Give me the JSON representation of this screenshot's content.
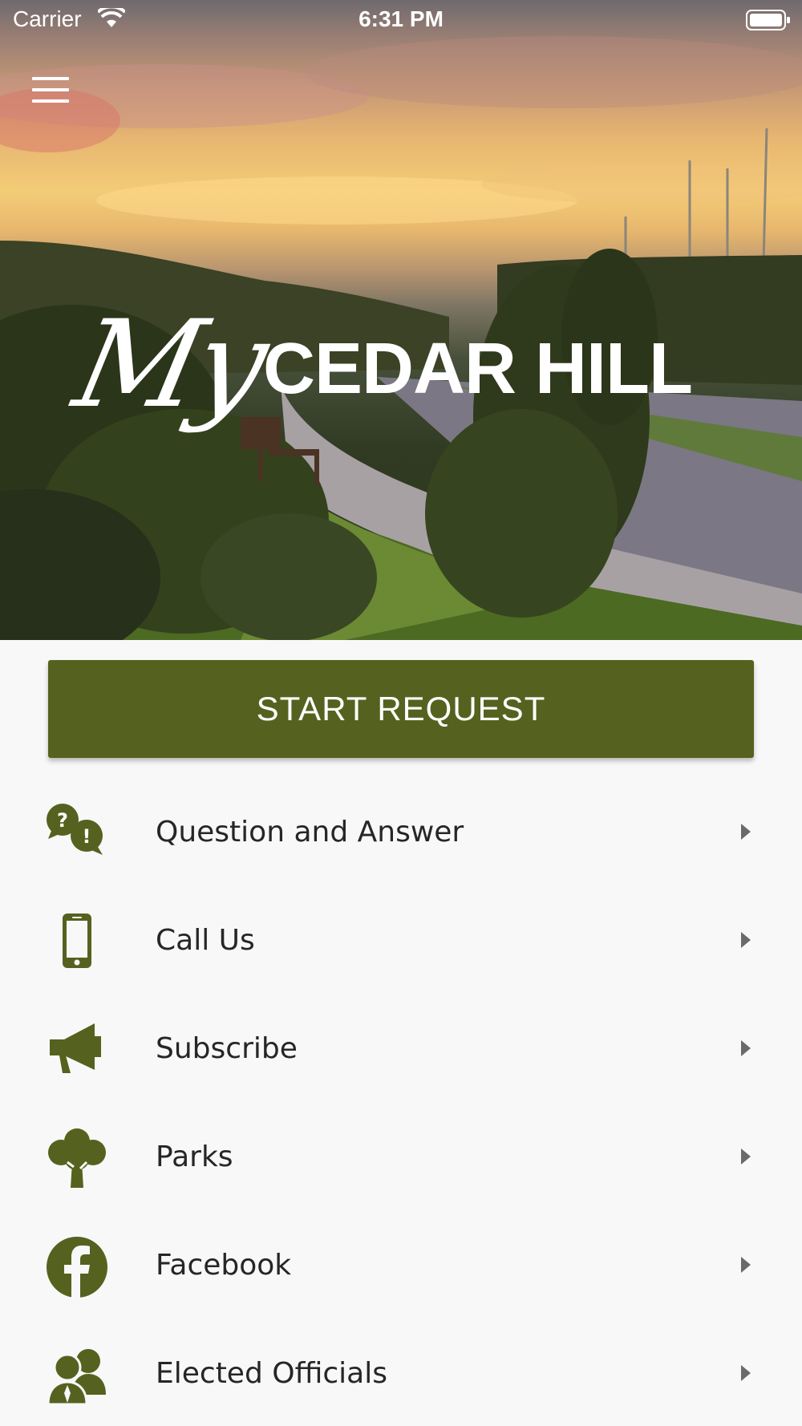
{
  "status_bar": {
    "carrier": "Carrier",
    "time": "6:31 PM"
  },
  "header": {
    "logo_script": "My",
    "logo_text": "CEDAR HILL",
    "menu_icon": "hamburger-icon"
  },
  "actions": {
    "start_request_label": "START REQUEST"
  },
  "menu": {
    "items": [
      {
        "label": "Question and Answer",
        "icon": "question-answer-icon"
      },
      {
        "label": "Call Us",
        "icon": "phone-icon"
      },
      {
        "label": "Subscribe",
        "icon": "megaphone-icon"
      },
      {
        "label": "Parks",
        "icon": "tree-icon"
      },
      {
        "label": "Facebook",
        "icon": "facebook-icon"
      },
      {
        "label": "Elected Officials",
        "icon": "officials-icon"
      }
    ]
  },
  "colors": {
    "brand_green": "#55621f",
    "list_background": "#f8f8f8",
    "text": "#262626"
  }
}
